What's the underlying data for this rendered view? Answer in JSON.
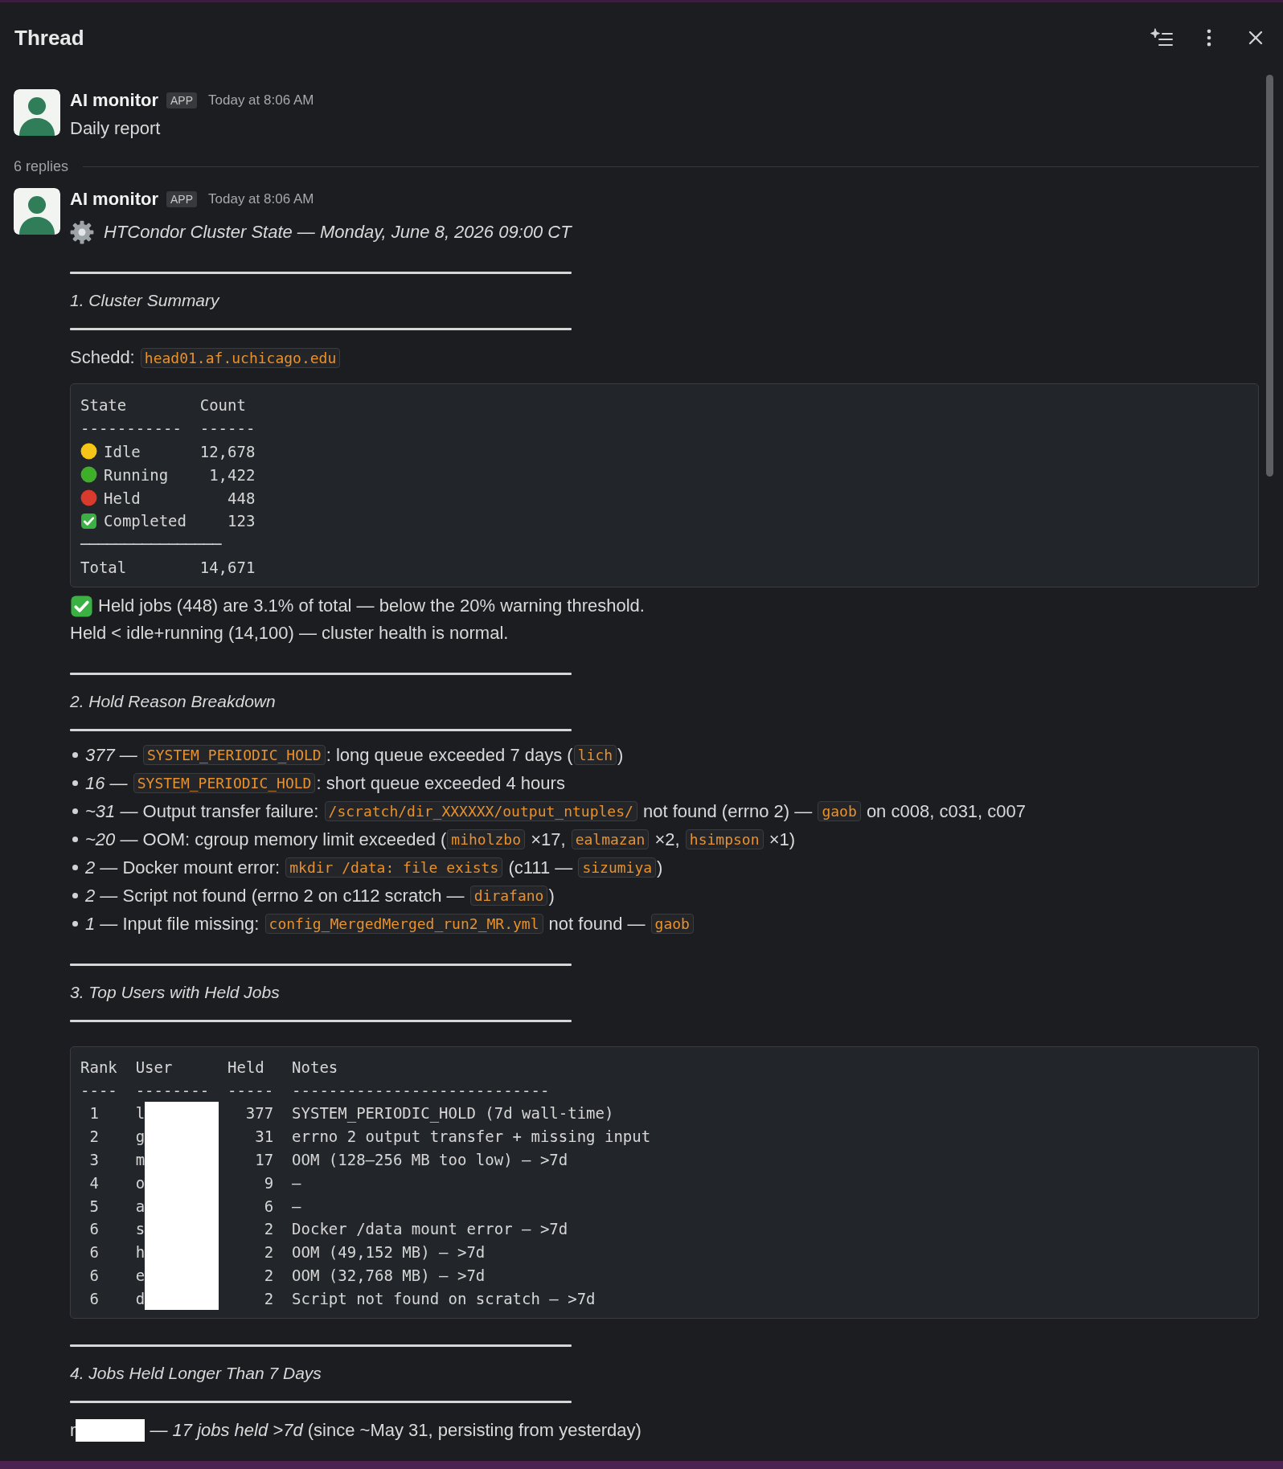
{
  "header": {
    "title": "Thread"
  },
  "parent": {
    "author": "AI monitor",
    "badge": "APP",
    "time": "Today at 8:06 AM",
    "text": "Daily report"
  },
  "replies_count": "6 replies",
  "reply": {
    "author": "AI monitor",
    "badge": "APP",
    "time": "Today at 8:06 AM",
    "title": "HTCondor Cluster State — Monday, June 8, 2026 09:00 CT",
    "blocks": [
      {
        "kind": "heading",
        "text": "1. Cluster Summary"
      },
      {
        "kind": "paragraph",
        "parts": [
          {
            "kind": "text",
            "text": "Schedd: "
          },
          {
            "kind": "code",
            "text": "head01.af.uchicago.edu"
          }
        ]
      },
      {
        "kind": "state_table",
        "columns": [
          "State",
          "Count"
        ],
        "rules": [
          "-----------",
          "------"
        ],
        "rows": [
          {
            "kind": "dot",
            "color": "#f5c518",
            "state": "Idle",
            "count": "12,678"
          },
          {
            "kind": "dot",
            "color": "#3fae29",
            "state": "Running",
            "count": "1,422"
          },
          {
            "kind": "dot",
            "color": "#d83a2e",
            "state": "Held",
            "count": "448"
          },
          {
            "kind": "check",
            "state": "Completed",
            "count": "123"
          }
        ],
        "separator": "────────────────",
        "total": {
          "label": "Total",
          "count": "14,671"
        }
      },
      {
        "kind": "notes",
        "lines": [
          {
            "kind": "check",
            "text": "Held jobs (448) are 3.1% of total — below the 20% warning threshold."
          },
          {
            "kind": "plain",
            "text": "Held < idle+running (14,100) — cluster health is normal."
          }
        ]
      },
      {
        "kind": "heading",
        "text": "2. Hold Reason Breakdown"
      },
      {
        "kind": "bullets",
        "items": [
          {
            "count": "377 —",
            "parts": [
              {
                "kind": "code",
                "text": "SYSTEM_PERIODIC_HOLD"
              },
              {
                "kind": "text",
                "text": ": long queue exceeded 7 days ("
              },
              {
                "kind": "code",
                "text": "lich"
              },
              {
                "kind": "text",
                "text": ")"
              }
            ]
          },
          {
            "count": "16 —",
            "parts": [
              {
                "kind": "code",
                "text": "SYSTEM_PERIODIC_HOLD"
              },
              {
                "kind": "text",
                "text": ": short queue exceeded 4 hours"
              }
            ]
          },
          {
            "count": "~31 —",
            "parts": [
              {
                "kind": "text",
                "text": "Output transfer failure: "
              },
              {
                "kind": "code",
                "text": "/scratch/dir_XXXXXX/output_ntuples/"
              },
              {
                "kind": "text",
                "text": " not found (errno 2) — "
              },
              {
                "kind": "code",
                "text": "gaob"
              },
              {
                "kind": "text",
                "text": " on c008, c031, c007"
              }
            ]
          },
          {
            "count": "~20 —",
            "parts": [
              {
                "kind": "text",
                "text": "OOM: cgroup memory limit exceeded ("
              },
              {
                "kind": "code",
                "text": "miholzbo"
              },
              {
                "kind": "text",
                "text": " ×17, "
              },
              {
                "kind": "code",
                "text": "ealmazan"
              },
              {
                "kind": "text",
                "text": " ×2, "
              },
              {
                "kind": "code",
                "text": "hsimpson"
              },
              {
                "kind": "text",
                "text": " ×1)"
              }
            ]
          },
          {
            "count": "2 —",
            "parts": [
              {
                "kind": "text",
                "text": "Docker mount error: "
              },
              {
                "kind": "code",
                "text": "mkdir /data: file exists"
              },
              {
                "kind": "text",
                "text": " (c111 — "
              },
              {
                "kind": "code",
                "text": "sizumiya"
              },
              {
                "kind": "text",
                "text": ")"
              }
            ]
          },
          {
            "count": "2 —",
            "parts": [
              {
                "kind": "text",
                "text": "Script not found (errno 2 on c112 scratch — "
              },
              {
                "kind": "code",
                "text": "dirafano"
              },
              {
                "kind": "text",
                "text": ")"
              }
            ]
          },
          {
            "count": "1 —",
            "parts": [
              {
                "kind": "text",
                "text": "Input file missing: "
              },
              {
                "kind": "code",
                "text": "config_MergedMerged_run2_MR.yml"
              },
              {
                "kind": "text",
                "text": " not found — "
              },
              {
                "kind": "code",
                "text": "gaob"
              }
            ]
          }
        ]
      },
      {
        "kind": "heading",
        "text": "3. Top Users with Held Jobs"
      },
      {
        "kind": "user_table",
        "columns": [
          "Rank",
          "User",
          "Held",
          "Notes"
        ],
        "rules": [
          "----",
          "--------",
          "-----",
          "----------------------------"
        ],
        "rows": [
          {
            "rank": "1",
            "user": "l",
            "redacted": true,
            "held": "377",
            "notes": "SYSTEM_PERIODIC_HOLD (7d wall-time)"
          },
          {
            "rank": "2",
            "user": "g",
            "redacted": true,
            "held": "31",
            "notes": "errno 2 output transfer + missing input"
          },
          {
            "rank": "3",
            "user": "m",
            "redacted": true,
            "held": "17",
            "notes": "OOM (128–256 MB too low) – >7d"
          },
          {
            "rank": "4",
            "user": "o",
            "redacted": true,
            "held": "9",
            "notes": "–"
          },
          {
            "rank": "5",
            "user": "a",
            "redacted": true,
            "held": "6",
            "notes": "–"
          },
          {
            "rank": "6",
            "user": "s",
            "redacted": true,
            "held": "2",
            "notes": "Docker /data mount error – >7d"
          },
          {
            "rank": "6",
            "user": "h",
            "redacted": true,
            "held": "2",
            "notes": "OOM (49,152 MB) – >7d"
          },
          {
            "rank": "6",
            "user": "e",
            "redacted": true,
            "held": "2",
            "notes": "OOM (32,768 MB) – >7d"
          },
          {
            "rank": "6",
            "user": "d",
            "redacted": true,
            "held": "2",
            "notes": "Script not found on scratch – >7d"
          }
        ]
      },
      {
        "kind": "heading",
        "text": "4. Jobs Held Longer Than 7 Days"
      },
      {
        "kind": "paragraph",
        "parts": [
          {
            "kind": "text",
            "text": "r"
          },
          {
            "kind": "redacted"
          },
          {
            "kind": "italic",
            "text": " — 17 jobs held >7d"
          },
          {
            "kind": "text",
            "text": " (since ~May 31, persisting from yesterday)"
          }
        ]
      }
    ]
  }
}
